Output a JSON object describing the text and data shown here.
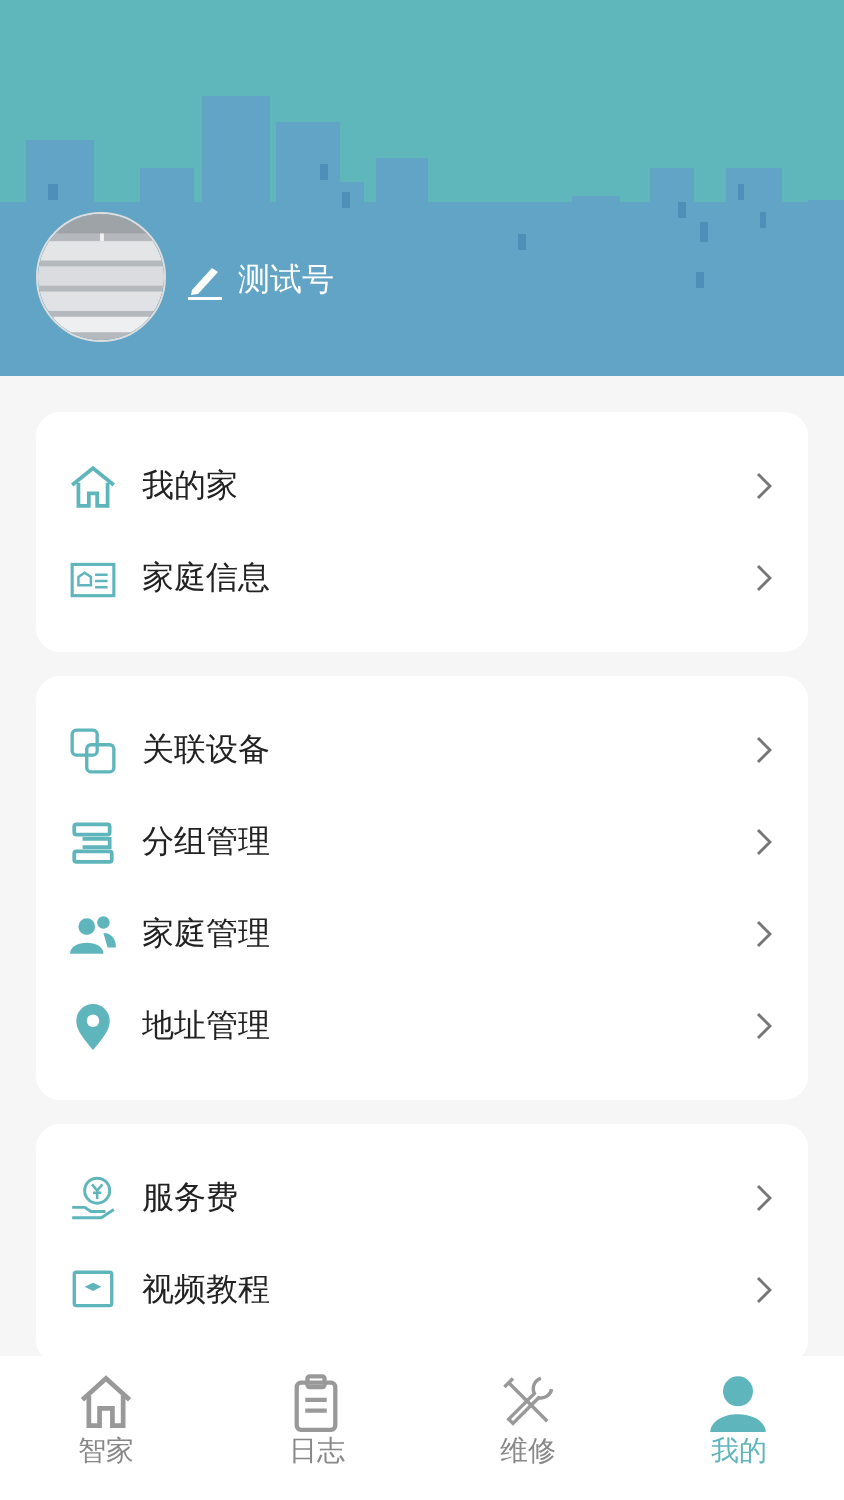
{
  "profile": {
    "nickname": "测试号"
  },
  "sections": [
    {
      "items": [
        {
          "label": "我的家"
        },
        {
          "label": "家庭信息"
        }
      ]
    },
    {
      "items": [
        {
          "label": "关联设备"
        },
        {
          "label": "分组管理"
        },
        {
          "label": "家庭管理"
        },
        {
          "label": "地址管理"
        }
      ]
    },
    {
      "items": [
        {
          "label": "服务费"
        },
        {
          "label": "视频教程"
        }
      ]
    }
  ],
  "tab_bar": [
    {
      "label": "智家",
      "selected": false
    },
    {
      "label": "日志",
      "selected": false
    },
    {
      "label": "维修",
      "selected": false
    },
    {
      "label": "我的",
      "selected": true
    }
  ]
}
